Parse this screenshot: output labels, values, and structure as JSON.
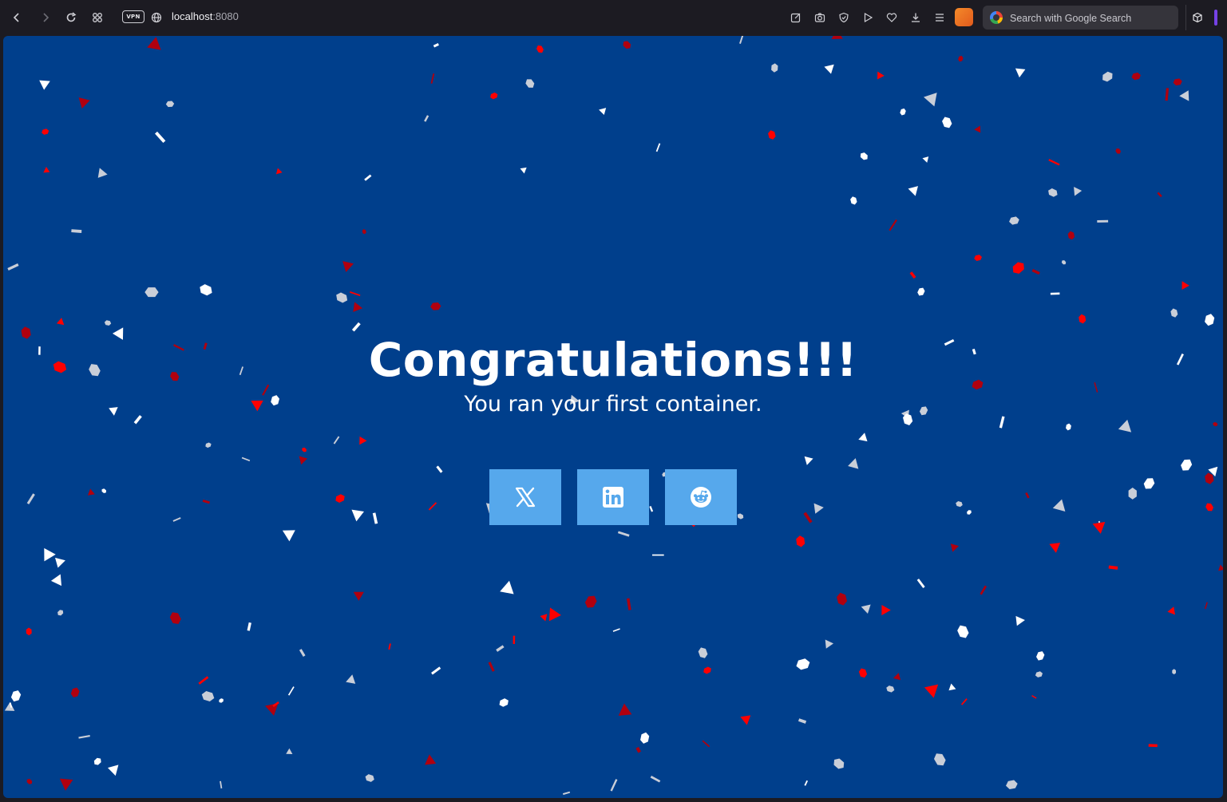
{
  "browser": {
    "url_host": "localhost",
    "url_port": ":8080",
    "vpn_label": "VPN",
    "search_placeholder": "Search with Google Search"
  },
  "page": {
    "heading": "Congratulations!!!",
    "subheading": "You ran your first container.",
    "background_color": "#003f8c",
    "button_color": "#56a8ec",
    "share_buttons": [
      {
        "name": "x-share-button",
        "icon": "x-logo-icon"
      },
      {
        "name": "linkedin-share-button",
        "icon": "linkedin-logo-icon"
      },
      {
        "name": "reddit-share-button",
        "icon": "reddit-logo-icon"
      }
    ],
    "confetti_colors": [
      "#ffffff",
      "#c9ced8",
      "#ff0000",
      "#b0000f"
    ]
  }
}
